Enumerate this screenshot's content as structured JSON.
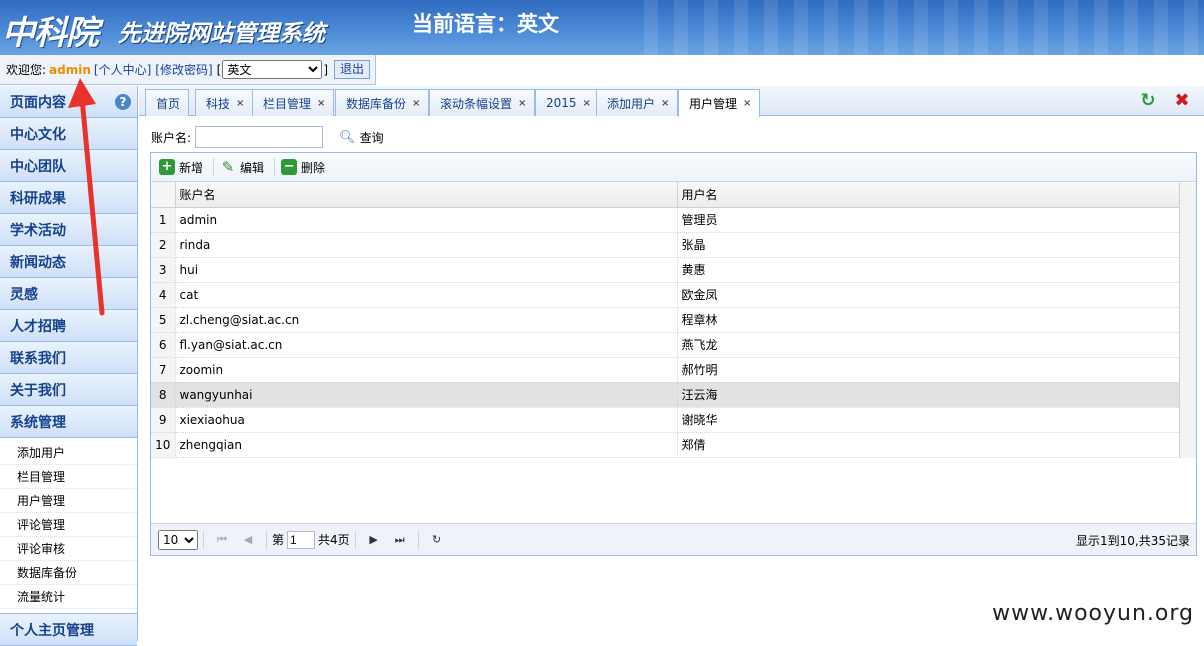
{
  "header": {
    "logo_main": "中科院",
    "logo_sub": "先进院网站管理系统",
    "current_language": "当前语言：英文"
  },
  "welcome": {
    "greeting": "欢迎您:",
    "username": "admin",
    "personal_center": "[个人中心]",
    "change_password": "[修改密码]",
    "bracket_open": "[",
    "bracket_close": "]",
    "language_selected": "英文",
    "logout": "退出"
  },
  "sidebar": {
    "help_glyph": "?",
    "sections": [
      {
        "label": "页面内容"
      },
      {
        "label": "中心文化"
      },
      {
        "label": "中心团队"
      },
      {
        "label": "科研成果"
      },
      {
        "label": "学术活动"
      },
      {
        "label": "新闻动态"
      },
      {
        "label": "灵感"
      },
      {
        "label": "人才招聘"
      },
      {
        "label": "联系我们"
      },
      {
        "label": "关于我们"
      },
      {
        "label": "系统管理"
      }
    ],
    "submenu": [
      "添加用户",
      "栏目管理",
      "用户管理",
      "评论管理",
      "评论审核",
      "数据库备份",
      "流量统计"
    ],
    "last_section": "个人主页管理"
  },
  "tabs": [
    {
      "label": "首页",
      "closable": false
    },
    {
      "label": "科技",
      "closable": true
    },
    {
      "label": "栏目管理",
      "closable": true
    },
    {
      "label": "数据库备份",
      "closable": true
    },
    {
      "label": "滚动条幅设置",
      "closable": true
    },
    {
      "label": "2015",
      "closable": true
    },
    {
      "label": "添加用户",
      "closable": true
    },
    {
      "label": "用户管理",
      "closable": true,
      "active": true
    }
  ],
  "tab_close_glyph": "×",
  "search": {
    "label": "账户名:",
    "value": "",
    "button": "查询"
  },
  "toolbar": {
    "add": "新增",
    "edit": "编辑",
    "delete": "删除"
  },
  "grid": {
    "columns": [
      "账户名",
      "用户名"
    ],
    "rows": [
      {
        "n": "1",
        "account": "admin",
        "name": "管理员"
      },
      {
        "n": "2",
        "account": "rinda",
        "name": "张晶"
      },
      {
        "n": "3",
        "account": "hui",
        "name": "黄惠"
      },
      {
        "n": "4",
        "account": "cat",
        "name": "欧金凤"
      },
      {
        "n": "5",
        "account": "zl.cheng@siat.ac.cn",
        "name": "程章林"
      },
      {
        "n": "6",
        "account": "fl.yan@siat.ac.cn",
        "name": "燕飞龙"
      },
      {
        "n": "7",
        "account": "zoomin",
        "name": "郝竹明"
      },
      {
        "n": "8",
        "account": "wangyunhai",
        "name": "汪云海"
      },
      {
        "n": "9",
        "account": "xiexiaohua",
        "name": "谢晓华"
      },
      {
        "n": "10",
        "account": "zhengqian",
        "name": "郑倩"
      }
    ],
    "selected_row": 8
  },
  "pager": {
    "page_size": "10",
    "page_prefix": "第",
    "page_value": "1",
    "page_suffix": "共4页",
    "info": "显示1到10,共35记录"
  },
  "watermark": "www.wooyun.org",
  "colors": {
    "annotation_arrow": "#e8322a",
    "username": "#f28b00",
    "link": "#1a3f9f"
  }
}
